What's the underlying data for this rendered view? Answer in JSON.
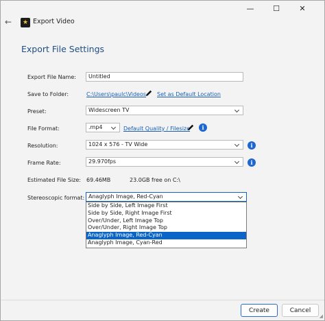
{
  "window": {
    "title": "Export Video",
    "minimize_glyph": "—",
    "maximize_glyph": "☐",
    "close_glyph": "✕",
    "back_glyph": "←"
  },
  "heading": "Export File Settings",
  "fields": {
    "file_name": {
      "label": "Export File Name:",
      "value": "Untitled"
    },
    "save_folder": {
      "label": "Save to Folder:",
      "path": "C:\\Users\\paulc\\Videos",
      "default_link": "Set as Default Location"
    },
    "preset": {
      "label": "Preset:",
      "value": "Widescreen TV"
    },
    "file_format": {
      "label": "File Format:",
      "value": ".mp4",
      "quality_link": "Default Quality / Filesize"
    },
    "resolution": {
      "label": "Resolution:",
      "value": "1024 x 576 - TV Wide"
    },
    "frame_rate": {
      "label": "Frame Rate:",
      "value": "29.970fps"
    },
    "file_size": {
      "label": "Estimated File Size:",
      "value": "69.46MB",
      "free_space": "23.0GB free on C:\\"
    },
    "stereo": {
      "label": "Stereoscopic format:",
      "value": "Anaglyph Image, Red-Cyan",
      "options": [
        "Side by Side, Left Image First",
        "Side by Side, Right Image First",
        "Over/Under, Left Image Top",
        "Over/Under, Right Image Top",
        "Anaglyph Image, Red-Cyan",
        "Anaglyph Image, Cyan-Red"
      ],
      "selected_index": 4
    }
  },
  "buttons": {
    "create": "Create",
    "cancel": "Cancel"
  },
  "icons": {
    "app": "videopad-star-icon",
    "edit": "pencil-icon",
    "info": "info-icon"
  },
  "colors": {
    "accent": "#1f66d1",
    "heading": "#1f4d83",
    "link": "#1a5fb4",
    "selected": "#0b64c8"
  }
}
